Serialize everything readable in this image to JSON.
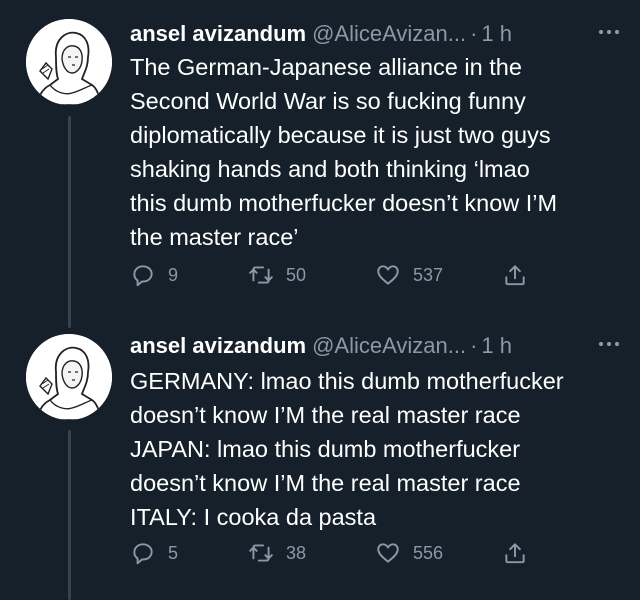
{
  "tweets": [
    {
      "author_name": "ansel avizandum",
      "handle": "@AliceAvizan...",
      "separator": "·",
      "time": "1 h",
      "more_icon": "more-dots-icon",
      "text": "The German-Japanese alliance in the\nSecond World War is so fucking funny\ndiplomatically because it is just two guys\nshaking hands and both thinking ‘lmao\nthis dumb motherfucker doesn’t know I’M\nthe master race’",
      "replies": "9",
      "retweets": "50",
      "likes": "537"
    },
    {
      "author_name": "ansel avizandum",
      "handle": "@AliceAvizan...",
      "separator": "·",
      "time": "1 h",
      "more_icon": "more-dots-icon",
      "text": "GERMANY: lmao this dumb motherfucker\ndoesn’t know I’M the real master race\nJAPAN: lmao this dumb motherfucker\ndoesn’t know I’M the real master race\nITALY: I cooka da pasta",
      "replies": "5",
      "retweets": "38",
      "likes": "556"
    }
  ],
  "theme": {
    "background": "#15202b",
    "text": "#ffffff",
    "muted": "#8b98a5",
    "thread_line": "#38444d"
  }
}
